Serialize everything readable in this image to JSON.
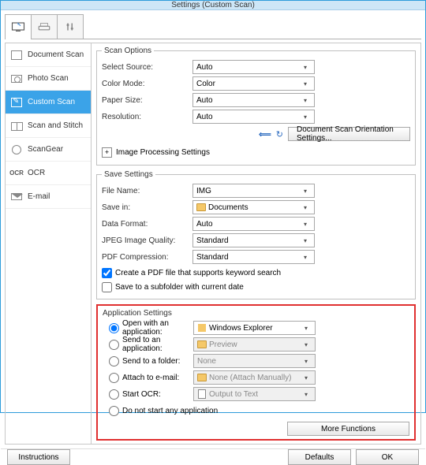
{
  "window": {
    "title": "Settings (Custom Scan)"
  },
  "sidebar": {
    "items": [
      {
        "label": "Document Scan"
      },
      {
        "label": "Photo Scan"
      },
      {
        "label": "Custom Scan"
      },
      {
        "label": "Scan and Stitch"
      },
      {
        "label": "ScanGear"
      },
      {
        "label": "OCR"
      },
      {
        "label": "E-mail"
      }
    ]
  },
  "scan_options": {
    "legend": "Scan Options",
    "select_source": {
      "label": "Select Source:",
      "value": "Auto"
    },
    "color_mode": {
      "label": "Color Mode:",
      "value": "Color"
    },
    "paper_size": {
      "label": "Paper Size:",
      "value": "Auto"
    },
    "resolution": {
      "label": "Resolution:",
      "value": "Auto"
    },
    "orientation_btn": "Document Scan Orientation Settings...",
    "image_processing": "Image Processing Settings"
  },
  "save_settings": {
    "legend": "Save Settings",
    "file_name": {
      "label": "File Name:",
      "value": "IMG"
    },
    "save_in": {
      "label": "Save in:",
      "value": "Documents"
    },
    "data_format": {
      "label": "Data Format:",
      "value": "Auto"
    },
    "jpeg_quality": {
      "label": "JPEG Image Quality:",
      "value": "Standard"
    },
    "pdf_compression": {
      "label": "PDF Compression:",
      "value": "Standard"
    },
    "cb_pdf_keyword": "Create a PDF file that supports keyword search",
    "cb_subfolder": "Save to a subfolder with current date"
  },
  "app_settings": {
    "legend": "Application Settings",
    "open_with": {
      "label": "Open with an application:",
      "value": "Windows Explorer"
    },
    "send_to_app": {
      "label": "Send to an application:",
      "value": "Preview"
    },
    "send_to_folder": {
      "label": "Send to a folder:",
      "value": "None"
    },
    "attach_email": {
      "label": "Attach to e-mail:",
      "value": "None (Attach Manually)"
    },
    "start_ocr": {
      "label": "Start OCR:",
      "value": "Output to Text"
    },
    "do_not_start": "Do not start any application",
    "more_functions": "More Functions"
  },
  "footer": {
    "instructions": "Instructions",
    "defaults": "Defaults",
    "ok": "OK"
  }
}
